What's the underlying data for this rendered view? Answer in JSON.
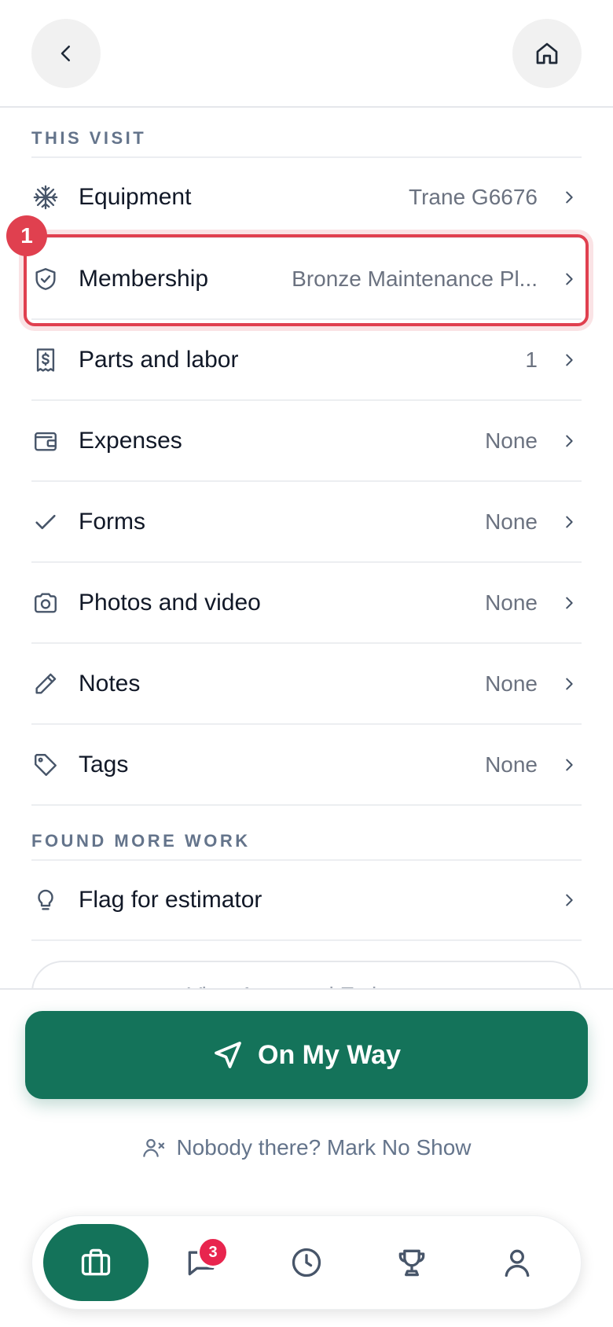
{
  "header": {
    "back_icon": "chevron-left-icon",
    "home_icon": "home-icon"
  },
  "sections": {
    "this_visit": "THIS VISIT",
    "found_more_work": "FOUND MORE WORK"
  },
  "rows": [
    {
      "icon": "snowflake-icon",
      "label": "Equipment",
      "value": "Trane G6676"
    },
    {
      "icon": "shield-check-icon",
      "label": "Membership",
      "value": "Bronze Maintenance Pl..."
    },
    {
      "icon": "receipt-icon",
      "label": "Parts and labor",
      "value": "1"
    },
    {
      "icon": "wallet-icon",
      "label": "Expenses",
      "value": "None"
    },
    {
      "icon": "check-icon",
      "label": "Forms",
      "value": "None"
    },
    {
      "icon": "camera-icon",
      "label": "Photos and video",
      "value": "None"
    },
    {
      "icon": "pencil-icon",
      "label": "Notes",
      "value": "None"
    },
    {
      "icon": "tag-icon",
      "label": "Tags",
      "value": "None"
    }
  ],
  "found_more_work": {
    "icon": "lightbulb-icon",
    "label": "Flag for estimator"
  },
  "partial_button": {
    "label": "View Approved Estimate"
  },
  "annotation": {
    "step": "1"
  },
  "cta": {
    "label": "On My Way",
    "icon": "navigation-arrow-icon"
  },
  "no_show": {
    "label": "Nobody there? Mark No Show",
    "icon": "user-x-icon"
  },
  "tabbar": {
    "tabs": [
      {
        "icon": "briefcase-icon",
        "active": true
      },
      {
        "icon": "chat-icon",
        "badge": "3"
      },
      {
        "icon": "clock-icon"
      },
      {
        "icon": "trophy-icon"
      },
      {
        "icon": "user-icon"
      }
    ]
  },
  "colors": {
    "primary": "#14735a",
    "highlight": "#e0404f",
    "badge": "#e8254e",
    "muted": "#64748b"
  }
}
